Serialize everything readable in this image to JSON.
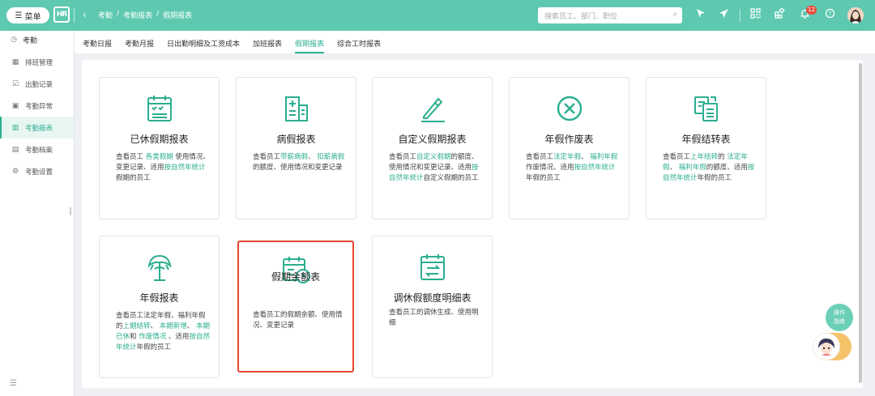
{
  "header": {
    "menu_label": "菜单",
    "logo_text": "HR",
    "breadcrumbs": [
      "考勤",
      "/",
      "考勤报表",
      "/",
      "假期报表"
    ],
    "search_placeholder": "搜索员工、部门、职位",
    "notification_count": "12"
  },
  "sidebar": {
    "title": "考勤",
    "items": [
      {
        "label": "排班管理",
        "icon": "calendar-grid-icon"
      },
      {
        "label": "出勤记录",
        "icon": "checklist-icon"
      },
      {
        "label": "考勤异常",
        "icon": "alert-doc-icon"
      },
      {
        "label": "考勤报表",
        "icon": "bar-chart-icon"
      },
      {
        "label": "考勤档案",
        "icon": "archive-icon"
      },
      {
        "label": "考勤设置",
        "icon": "gear-icon"
      }
    ],
    "active_item": "考勤报表"
  },
  "tabs": [
    "考勤日报",
    "考勤月报",
    "日出勤明细及工资成本",
    "加班报表",
    "假期报表",
    "综合工时报表"
  ],
  "active_tab": "假期报表",
  "cards": [
    {
      "title": "已休假期报表",
      "icon": "calendar-check-icon"
    },
    {
      "title": "病假报表",
      "icon": "hospital-icon"
    },
    {
      "title": "自定义假期报表",
      "icon": "pen-icon"
    },
    {
      "title": "年假作废表",
      "icon": "x-circle-icon"
    },
    {
      "title": "年假结转表",
      "icon": "transfer-doc-icon"
    },
    {
      "title": "年假报表",
      "icon": "palm-tree-icon"
    },
    {
      "title": "假期余额表",
      "icon": "calendar-clock-icon"
    },
    {
      "title": "调休假额度明细表",
      "icon": "calendar-swap-icon"
    }
  ],
  "desc": {
    "c1": {
      "a": "查看员工 ",
      "b": "各类假期",
      "c": " 使用情况、变更记录、适用",
      "d": "按自然年统计",
      "e": "假期的员工"
    },
    "c2": {
      "a": "查看员工",
      "b": "带薪病假",
      "c": "、 ",
      "d": "扣薪病假",
      "e": "的额度、使用情况和变更记录"
    },
    "c3": {
      "a": "查看员工",
      "b": "自定义假期",
      "c": "的额度、使用情况和变更记录、适用",
      "d": "按自然年统计",
      "e": "自定义假期的员工"
    },
    "c4": {
      "a": "查看员工",
      "b": "法定年假",
      "c": "、 ",
      "d": "福利年假",
      "e": "作废情况、适用",
      "f": "按自然年统计",
      "g": "年假的员工"
    },
    "c5": {
      "a": "查看员工",
      "b": "上年结转",
      "c": "的 ",
      "d": "法定年假",
      "e": "、 ",
      "f": "福利年假",
      "g": "的额度、适用",
      "h": "按自然年统计",
      "i": "年假的员工"
    },
    "c6": {
      "a": "查看员工法定年假、福利年假的",
      "b": "上期结转",
      "c": "、 ",
      "d": "本期新增",
      "e": "、 ",
      "f": "本期已休",
      "g": "和 ",
      "h": "作废情况",
      "i": " 、适用",
      "j": "按自然年统计",
      "k": "年假的员工"
    },
    "c7": {
      "a": "查看员工的假期余额、使用情况、变更记录"
    },
    "c8": {
      "a": "查看员工的调休生成、使用明细"
    }
  },
  "floating": {
    "guide_label_1": "操作",
    "guide_label_2": "指南"
  },
  "colors": {
    "accent": "#5ec9b0",
    "highlight": "#2bae8f",
    "selected_border": "#e8452e"
  }
}
